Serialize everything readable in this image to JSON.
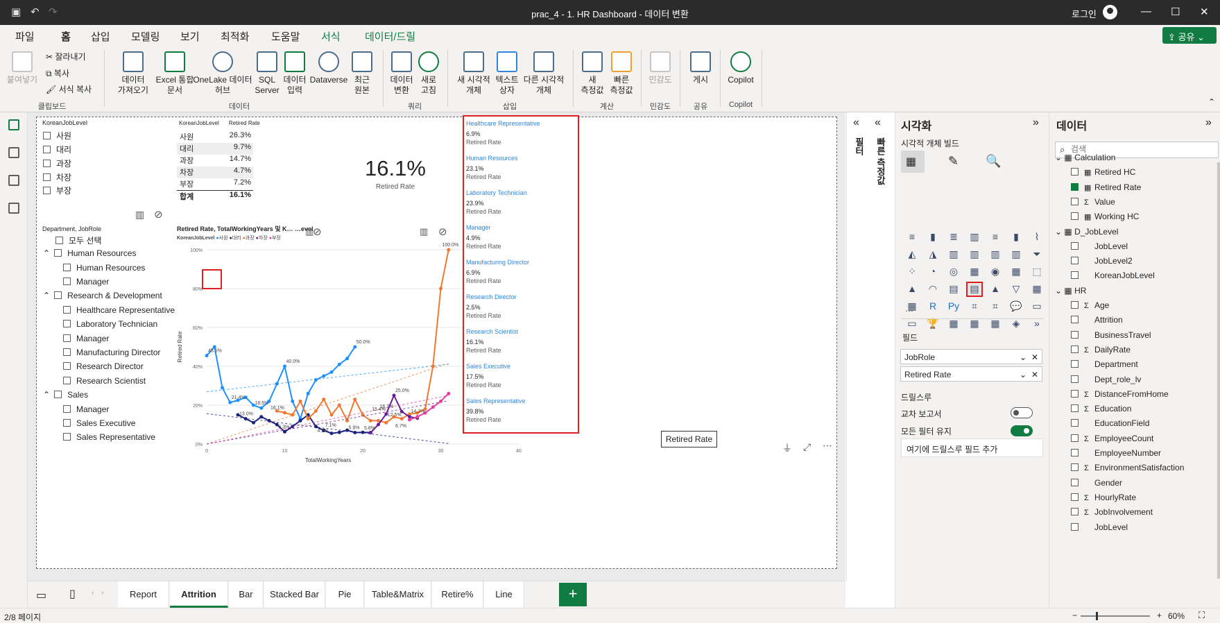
{
  "titlebar": {
    "title": "prac_4 - 1. HR Dashboard - 데이터 변환",
    "login": "로그인"
  },
  "menu": {
    "tabs": [
      "파일",
      "홈",
      "삽입",
      "모델링",
      "보기",
      "최적화",
      "도움말",
      "서식",
      "데이터/드릴"
    ],
    "share": "공유"
  },
  "ribbon": {
    "paste": "붙여넣기",
    "cut": "잘라내기",
    "copy": "복사",
    "format_painter": "서식 복사",
    "clipboard_group": "클립보드",
    "get_data": "데이터\n가져오기",
    "excel": "Excel 통합\n문서",
    "onelake": "OneLake 데이터\n허브",
    "sql": "SQL\nServer",
    "enter_data": "데이터\n입력",
    "dataverse": "Dataverse",
    "recent": "최근\n원본",
    "data_group": "데이터",
    "transform": "데이터\n변환",
    "refresh": "새로\n고침",
    "query_group": "쿼리",
    "new_visual": "새 시각적\n개체",
    "textbox": "텍스트\n상자",
    "more_visuals": "다른 시각적\n개체",
    "insert_group": "삽입",
    "new_measure": "새\n측정값",
    "quick_measure": "빠른\n측정값",
    "calc_group": "계산",
    "sensitivity": "민감도",
    "sensitivity_group": "민감도",
    "publish": "게시",
    "share_group": "공유",
    "copilot": "Copilot",
    "copilot_group": "Copilot"
  },
  "report": {
    "slicer1": {
      "title": "KoreanJobLevel",
      "items": [
        "사원",
        "대리",
        "과장",
        "차장",
        "부장"
      ]
    },
    "table": {
      "headers": [
        "KoreanJobLevel",
        "Retired Rate"
      ],
      "rows": [
        [
          "사원",
          "26.3%"
        ],
        [
          "대리",
          "9.7%"
        ],
        [
          "과장",
          "14.7%"
        ],
        [
          "차장",
          "4.7%"
        ],
        [
          "부장",
          "7.2%"
        ]
      ],
      "total": [
        "합계",
        "16.1%"
      ]
    },
    "card": {
      "value": "16.1%",
      "label": "Retired Rate"
    },
    "slicer2": {
      "title": "Department, JobRole",
      "select_all": "모두 선택",
      "groups": [
        {
          "name": "Human Resources",
          "items": [
            "Human Resources",
            "Manager"
          ]
        },
        {
          "name": "Research & Development",
          "items": [
            "Healthcare Representative",
            "Laboratory Technician",
            "Manager",
            "Manufacturing Director",
            "Research Director",
            "Research Scientist"
          ]
        },
        {
          "name": "Sales",
          "items": [
            "Manager",
            "Sales Executive",
            "Sales Representative"
          ]
        }
      ]
    },
    "multicard": [
      {
        "title": "Healthcare Representative",
        "value": "6.9%",
        "label": "Retired Rate"
      },
      {
        "title": "Human Resources",
        "value": "23.1%",
        "label": "Retired Rate"
      },
      {
        "title": "Laboratory Technician",
        "value": "23.9%",
        "label": "Retired Rate"
      },
      {
        "title": "Manager",
        "value": "4.9%",
        "label": "Retired Rate"
      },
      {
        "title": "Manufacturing Director",
        "value": "6.9%",
        "label": "Retired Rate"
      },
      {
        "title": "Research Director",
        "value": "2.5%",
        "label": "Retired Rate"
      },
      {
        "title": "Research Scientist",
        "value": "16.1%",
        "label": "Retired Rate"
      },
      {
        "title": "Sales Executive",
        "value": "17.5%",
        "label": "Retired Rate"
      },
      {
        "title": "Sales Representative",
        "value": "39.8%",
        "label": "Retired Rate"
      }
    ],
    "tooltip": "Retired Rate"
  },
  "chart_data": {
    "type": "line",
    "title": "Retired Rate, TotalWorkingYears 및 K… …evel",
    "legend_title": "KoreanJobLevel",
    "xlabel": "TotalWorkingYears",
    "ylabel": "Retired Rate",
    "xlim": [
      0,
      40
    ],
    "ylim": [
      0,
      100
    ],
    "xticks": [
      "0",
      "10",
      "20",
      "30",
      "40"
    ],
    "yticks": [
      "0%",
      "20%",
      "40%",
      "60%",
      "80%",
      "100%"
    ],
    "series": [
      {
        "name": "사원",
        "color": "#1e90ff",
        "x": [
          0,
          1,
          2,
          3,
          4,
          5,
          6,
          7,
          8,
          9,
          10,
          11,
          12,
          13,
          14,
          15,
          16,
          17,
          18,
          19
        ],
        "y": [
          45.5,
          50,
          29,
          21.4,
          22.5,
          24,
          20,
          18.5,
          22,
          31,
          40,
          22,
          13,
          26,
          33,
          35,
          37,
          41,
          44,
          50
        ]
      },
      {
        "name": "대리",
        "color": "#1a237e",
        "x": [
          4,
          5,
          6,
          7,
          8,
          9,
          10,
          11,
          12,
          13,
          14,
          15,
          16,
          17,
          18,
          19,
          20,
          21
        ],
        "y": [
          15,
          13,
          11,
          14,
          12,
          10,
          6.3,
          9,
          12,
          15,
          9,
          7,
          5.5,
          6,
          7.1,
          5.9,
          6,
          5.9
        ]
      },
      {
        "name": "과장",
        "color": "#f07830",
        "x": [
          9,
          10,
          11,
          12,
          13,
          14,
          15,
          16,
          17,
          18,
          19,
          20,
          21,
          22,
          23,
          24,
          25,
          26,
          27,
          28,
          29,
          30,
          31
        ],
        "y": [
          17,
          16.1,
          15,
          22,
          13,
          17,
          23,
          15,
          20,
          12,
          23,
          15,
          12,
          12,
          11,
          14,
          13,
          15.4,
          16,
          18,
          40,
          80,
          100
        ]
      },
      {
        "name": "차장",
        "color": "#6a1b9a",
        "x": [
          21,
          22,
          23,
          24,
          25,
          26,
          27
        ],
        "y": [
          5.8,
          10,
          15.4,
          25,
          16.7,
          14,
          13.3
        ]
      },
      {
        "name": "부장",
        "color": "#e040a0",
        "x": [
          26,
          27,
          28,
          29,
          30,
          31
        ],
        "y": [
          12.5,
          14,
          16,
          19,
          22,
          26
        ]
      }
    ],
    "data_labels": [
      "45.5%",
      "21.4%",
      "13.0%",
      "40.0%",
      "50.0%",
      "18.5%",
      "16.1%",
      "6.3%",
      "7.1%",
      "4.2%",
      "5.9%",
      "5.8%",
      "15.4%",
      "25.0%",
      "16.7%",
      "14.3%",
      "12.5%",
      "6.7%",
      "100.0%"
    ]
  },
  "filters": {
    "label": "필터",
    "quick_measure": "빠른 측정값"
  },
  "vis": {
    "title": "시각화",
    "build": "시각적 개체 빌드",
    "fields_label": "필드",
    "fields": [
      "JobRole",
      "Retired Rate"
    ],
    "drill": "드릴스루",
    "cross": "교차 보고서",
    "keep": "모든 필터 유지",
    "add_drill": "여기에 드릴스루 필드 추가",
    "more": "…"
  },
  "data": {
    "title": "데이터",
    "search_placeholder": "검색",
    "tables": [
      {
        "name": "Calculation",
        "items": [
          "Retired HC",
          "Retired Rate",
          "Value",
          "Working HC"
        ]
      },
      {
        "name": "D_JobLevel",
        "items": [
          "JobLevel",
          "JobLevel2",
          "KoreanJobLevel"
        ]
      },
      {
        "name": "HR",
        "items": [
          "Age",
          "Attrition",
          "BusinessTravel",
          "DailyRate",
          "Department",
          "Dept_role_lv",
          "DistanceFromHome",
          "Education",
          "EducationField",
          "EmployeeCount",
          "EmployeeNumber",
          "EnvironmentSatisfaction",
          "Gender",
          "HourlyRate",
          "JobInvolvement",
          "JobLevel"
        ]
      }
    ]
  },
  "pages": [
    "Report",
    "Attrition",
    "Bar",
    "Stacked Bar",
    "Pie",
    "Table&Matrix",
    "Retire%",
    "Line"
  ],
  "status": {
    "page": "2/8 페이지",
    "zoom": "60%"
  }
}
